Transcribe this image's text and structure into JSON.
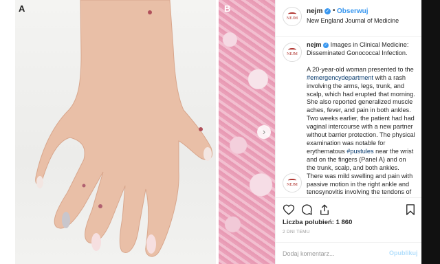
{
  "media": {
    "panel_a_label": "A",
    "panel_b_label": "B",
    "carousel_arrow": "›"
  },
  "header": {
    "avatar_text": "NEJM",
    "username": "nejm",
    "separator": "•",
    "follow_label": "Obserwuj",
    "subtitle": "New England Journal of Medicine",
    "more_label": "•••"
  },
  "caption": {
    "username": "nejm",
    "title": "Images in Clinical Medicine: Disseminated Gonococcal Infection.",
    "text_1": "A 20-year-old woman presented to the ",
    "tag_1": "#emergencydepartment",
    "text_2": " with a rash involving the arms, legs, trunk, and scalp, which had erupted that morning. She also reported generalized muscle aches, fever, and pain in both ankles. Two weeks earlier, the patient had had vaginal intercourse with a new partner without barrier protection. The physical examination was notable for erythematous ",
    "tag_2": "#pustules",
    "text_3": " near the wrist and on the fingers (Panel A) and on the trunk, scalp, and both ankles. There was mild swelling and pain with passive motion in the right ankle and tenosynovitis involving the tendons of"
  },
  "actions": {
    "icons": [
      "heart-icon",
      "comment-icon",
      "share-icon",
      "bookmark-icon"
    ]
  },
  "likes_text": "Liczba polubień: 1 860",
  "timestamp": "2 DNI TEMU",
  "comment": {
    "placeholder": "Dodaj komentarz...",
    "post_label": "Opublikuj"
  },
  "colors": {
    "link_blue": "#3897f0",
    "tag_blue": "#003569",
    "brand_red": "#b0342f",
    "post_disabled": "#b2dffc"
  }
}
